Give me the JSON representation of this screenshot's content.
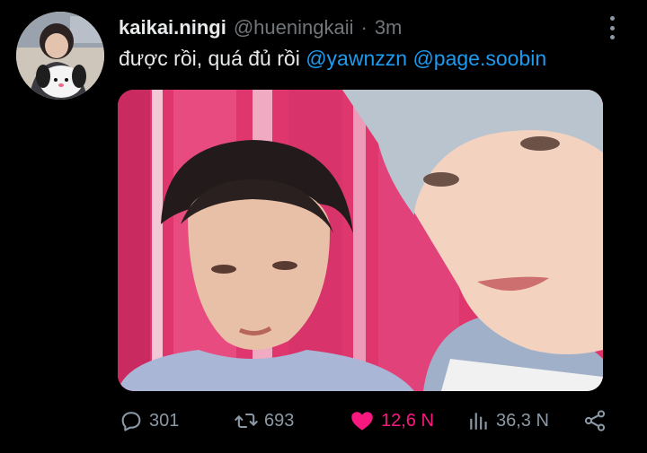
{
  "tweet": {
    "display_name": "kaikai.ningi",
    "handle": "@hueningkaii",
    "separator": "·",
    "time": "3m",
    "text_prefix": "được rồi, quá đủ rồi",
    "mentions": [
      "@yawnzzn",
      "@page.soobin"
    ]
  },
  "metrics": {
    "replies": "301",
    "retweets": "693",
    "likes": "12,6 N",
    "views": "36,3 N"
  },
  "icons": {
    "reply": "speech-bubble-icon",
    "retweet": "retweet-icon",
    "like": "heart-icon",
    "views": "bar-chart-icon",
    "share": "share-icon",
    "more": "vertical-dots-icon"
  },
  "colors": {
    "background": "#000000",
    "text": "#e7e9ea",
    "muted": "#71767b",
    "mention": "#1d9bf0",
    "like_active": "#f91880"
  }
}
